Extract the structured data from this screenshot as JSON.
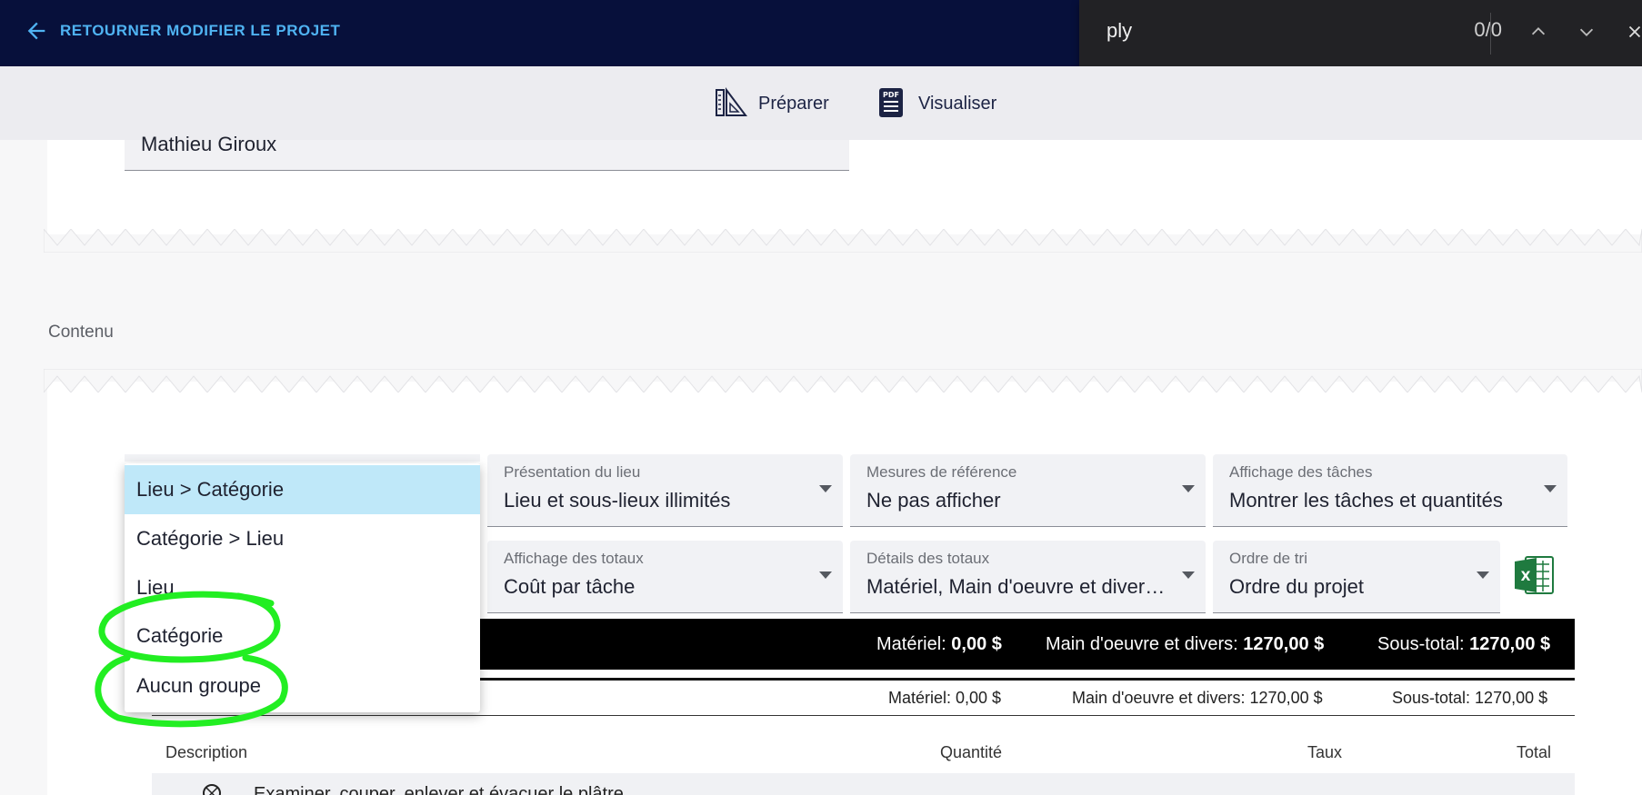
{
  "topbar": {
    "back_label": "RETOURNER MODIFIER LE PROJET"
  },
  "findbar": {
    "query": "ply",
    "count": "0/0"
  },
  "tabs": [
    {
      "label": "Préparer",
      "icon": "ruler-triangle-icon",
      "active": true
    },
    {
      "label": "Visualiser",
      "icon": "pdf-document-icon",
      "active": false
    }
  ],
  "upper": {
    "name_value": "Mathieu Giroux"
  },
  "section": {
    "label": "Contenu"
  },
  "selects": [
    {
      "label": "Présentation du lieu",
      "value": "Lieu et sous-lieux illimités"
    },
    {
      "label": "Mesures de référence",
      "value": "Ne pas afficher"
    },
    {
      "label": "Affichage des tâches",
      "value": "Montrer les tâches et quantités"
    },
    {
      "label": "Affichage des totaux",
      "value": "Coût par tâche"
    },
    {
      "label": "Détails des totaux",
      "value": "Matériel, Main d'oeuvre et diver…"
    },
    {
      "label": "Ordre de tri",
      "value": "Ordre du projet"
    }
  ],
  "menu": {
    "items": [
      "Lieu > Catégorie",
      "Catégorie > Lieu",
      "Lieu",
      "Catégorie",
      "Aucun groupe"
    ],
    "selected_index": 0
  },
  "totals_black": {
    "material_label": "Matériel:",
    "material_value": "0,00 $",
    "labor_label": "Main d'oeuvre et divers:",
    "labor_value": "1270,00 $",
    "subtotal_label": "Sous-total:",
    "subtotal_value": "1270,00 $"
  },
  "totals_light": {
    "material": "Matériel: 0,00 $",
    "labor": "Main d'oeuvre et divers: 1270,00 $",
    "subtotal": "Sous-total: 1270,00 $"
  },
  "table": {
    "headers": {
      "description": "Description",
      "quantity": "Quantité",
      "rate": "Taux",
      "total": "Total"
    },
    "first_row_desc": "Examiner, couper, enlever et évacuer le plâtre"
  },
  "colors": {
    "topbar": "#07103b",
    "accent": "#2ea8dc",
    "link": "#4fb3f2",
    "menu_selected": "#bfe8f9",
    "annotation": "#22ee22",
    "excel": "#1f7a3f"
  }
}
